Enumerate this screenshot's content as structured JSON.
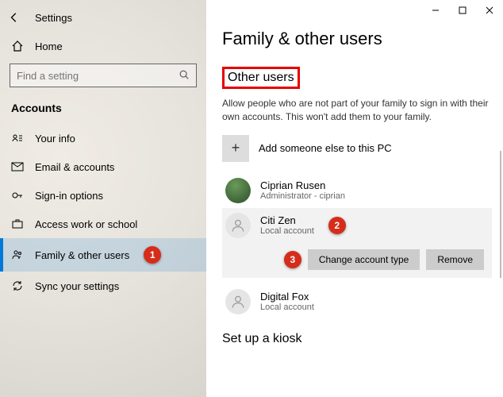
{
  "header": {
    "settings": "Settings"
  },
  "sidebar": {
    "home": "Home",
    "search_placeholder": "Find a setting",
    "section": "Accounts",
    "items": [
      {
        "label": "Your info"
      },
      {
        "label": "Email & accounts"
      },
      {
        "label": "Sign-in options"
      },
      {
        "label": "Access work or school"
      },
      {
        "label": "Family & other users"
      },
      {
        "label": "Sync your settings"
      }
    ]
  },
  "main": {
    "title": "Family & other users",
    "other_users_heading": "Other users",
    "description": "Allow people who are not part of your family to sign in with their own accounts. This won't add them to your family.",
    "add_label": "Add someone else to this PC",
    "users": [
      {
        "name": "Ciprian Rusen",
        "sub": "Administrator - ciprian"
      },
      {
        "name": "Citi Zen",
        "sub": "Local account"
      },
      {
        "name": "Digital Fox",
        "sub": "Local account"
      }
    ],
    "change_btn": "Change account type",
    "remove_btn": "Remove",
    "kiosk_heading": "Set up a kiosk"
  },
  "badges": {
    "b1": "1",
    "b2": "2",
    "b3": "3"
  }
}
